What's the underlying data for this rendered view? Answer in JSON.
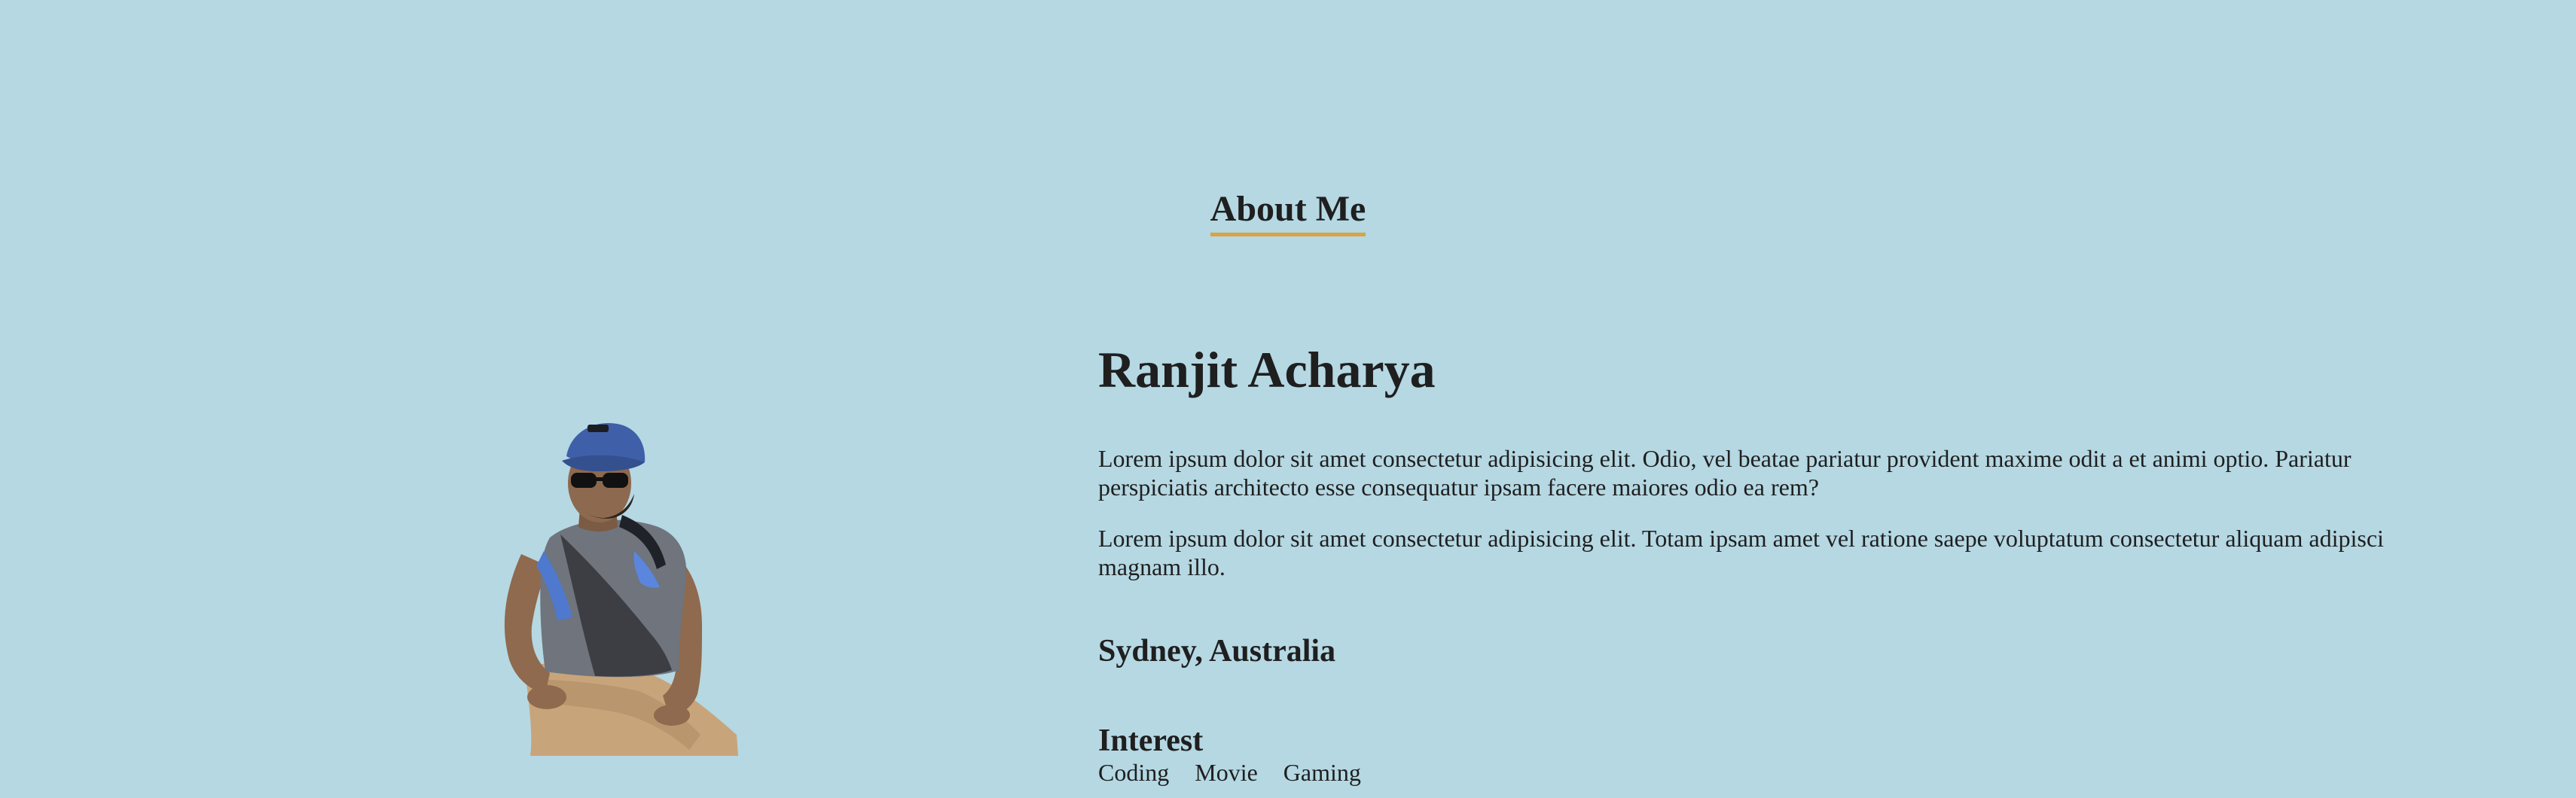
{
  "section": {
    "title": "About Me",
    "accent_color": "#d9a441",
    "background_color": "#b5d8e3"
  },
  "profile": {
    "image_alt": "profile-photo",
    "name": "Ranjit Acharya",
    "paragraphs": [
      "Lorem ipsum dolor sit amet consectetur adipisicing elit. Odio, vel beatae pariatur provident maxime odit a et animi optio. Pariatur perspiciatis architecto esse consequatur ipsam facere maiores odio ea rem?",
      "Lorem ipsum dolor sit amet consectetur adipisicing elit. Totam ipsam amet vel ratione saepe voluptatum consectetur aliquam adipisci magnam illo."
    ],
    "location": "Sydney, Australia",
    "interest_title": "Interest",
    "interests": [
      "Coding",
      "Movie",
      "Gaming"
    ]
  }
}
